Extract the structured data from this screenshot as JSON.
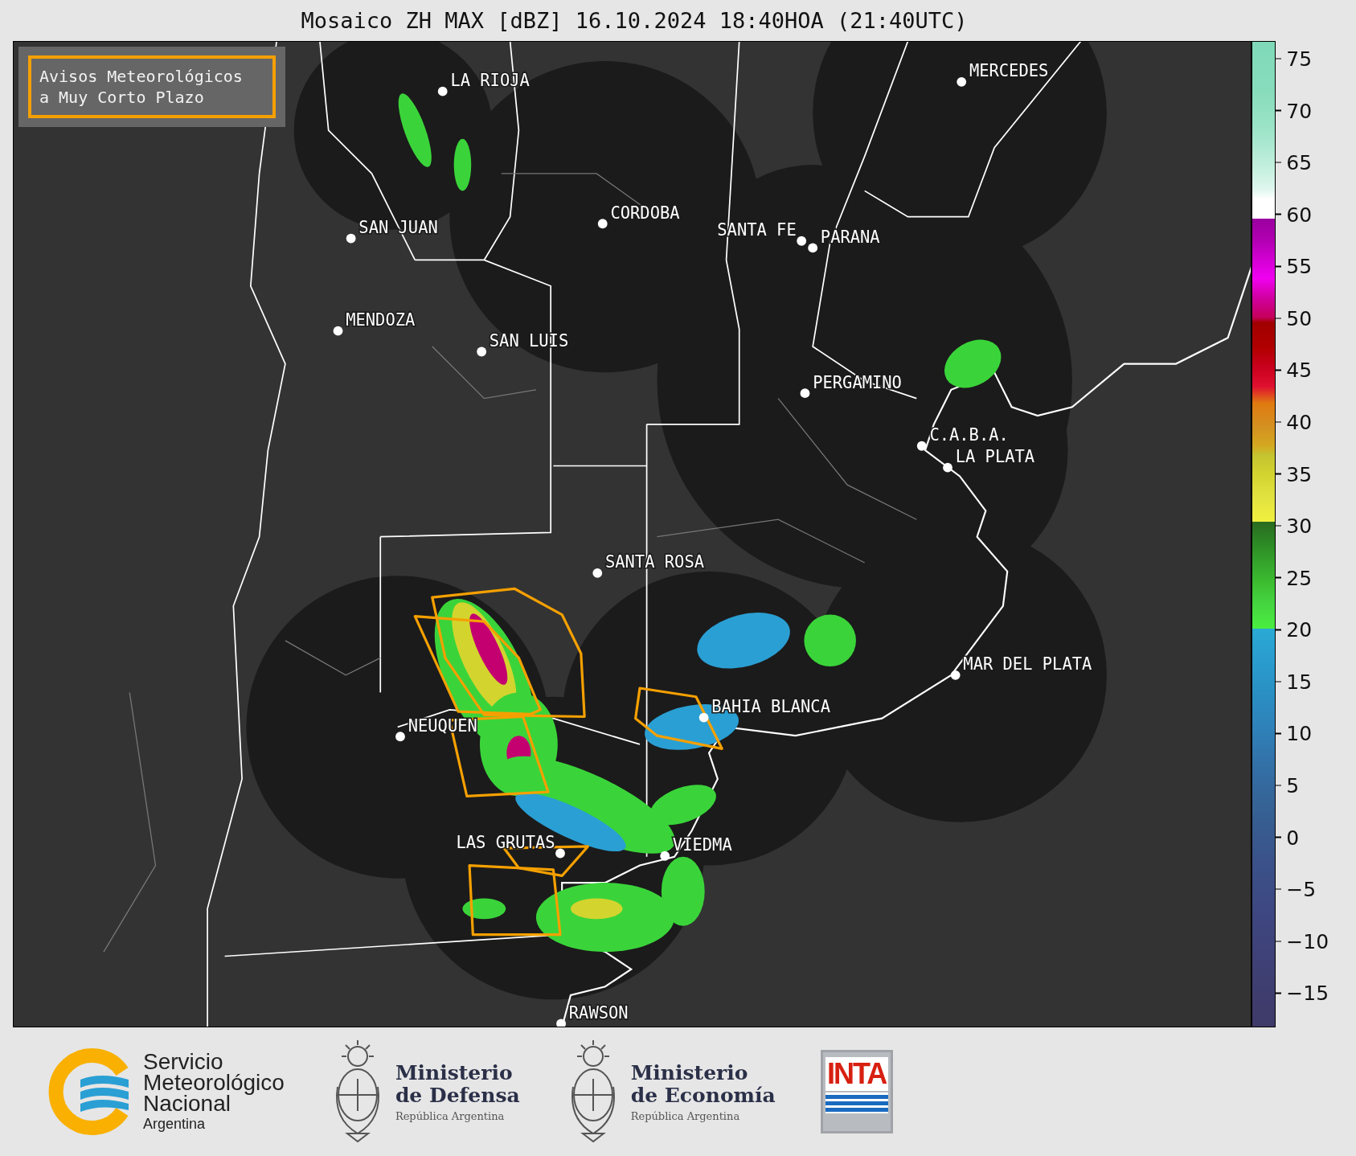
{
  "title": "Mosaico ZH MAX [dBZ] 16.10.2024 18:40HOA (21:40UTC)",
  "legend": {
    "lines": [
      "Avisos Meteorológicos",
      "a Muy Corto Plazo"
    ]
  },
  "cities": [
    {
      "name": "LA RIOJA"
    },
    {
      "name": "SAN JUAN"
    },
    {
      "name": "CORDOBA"
    },
    {
      "name": "SANTA FE"
    },
    {
      "name": "PARANA"
    },
    {
      "name": "MERCEDES"
    },
    {
      "name": "MENDOZA"
    },
    {
      "name": "SAN LUIS"
    },
    {
      "name": "PERGAMINO"
    },
    {
      "name": "C.A.B.A."
    },
    {
      "name": "LA PLATA"
    },
    {
      "name": "SANTA ROSA"
    },
    {
      "name": "MAR DEL PLATA"
    },
    {
      "name": "BAHIA BLANCA"
    },
    {
      "name": "NEUQUEN"
    },
    {
      "name": "VIEDMA"
    },
    {
      "name": "LAS GRUTAS"
    },
    {
      "name": "RAWSON"
    }
  ],
  "colorbar": {
    "ticks": [
      "75",
      "70",
      "65",
      "60",
      "55",
      "50",
      "45",
      "40",
      "35",
      "30",
      "25",
      "20",
      "15",
      "10",
      "5",
      "0",
      "−5",
      "−10",
      "−15"
    ]
  },
  "footer": {
    "smn": {
      "lines": [
        "Servicio",
        "Meteorológico",
        "Nacional"
      ],
      "country": "Argentina"
    },
    "defensa": {
      "lines": [
        "Ministerio",
        "de Defensa"
      ],
      "sub": "República Argentina"
    },
    "economia": {
      "lines": [
        "Ministerio",
        "de Economía"
      ],
      "sub": "República Argentina"
    },
    "inta": {
      "text": "INTA"
    }
  }
}
